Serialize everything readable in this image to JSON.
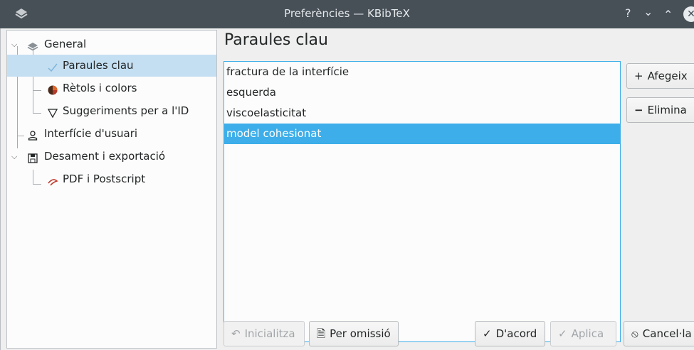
{
  "window": {
    "title": "Preferències — KBibTeX",
    "help": "?",
    "minimize": "⌄",
    "maximize": "⌃",
    "close": "✕"
  },
  "sidebar": {
    "items": [
      {
        "label": "General"
      },
      {
        "label": "Paraules clau"
      },
      {
        "label": "Rètols i colors"
      },
      {
        "label": "Suggeriments per a l'ID"
      },
      {
        "label": "Interfície d'usuari"
      },
      {
        "label": "Desament i exportació"
      },
      {
        "label": "PDF i Postscript"
      }
    ]
  },
  "main": {
    "title": "Paraules clau",
    "keywords": [
      "fractura de la interfície",
      "esquerda",
      "viscoelasticitat",
      "model cohesionat"
    ],
    "selected_keyword": "model cohesionat",
    "add_label": "Afegeix",
    "remove_label": "Elimina"
  },
  "footer": {
    "reset_label": "Inicialitza",
    "defaults_label": "Per omissió",
    "ok_label": "D'acord",
    "apply_label": "Aplica",
    "cancel_label": "Cancel·la"
  },
  "colors": {
    "accent": "#3daee9",
    "selection_light": "#c5dff2",
    "titlebar": "#475057"
  }
}
